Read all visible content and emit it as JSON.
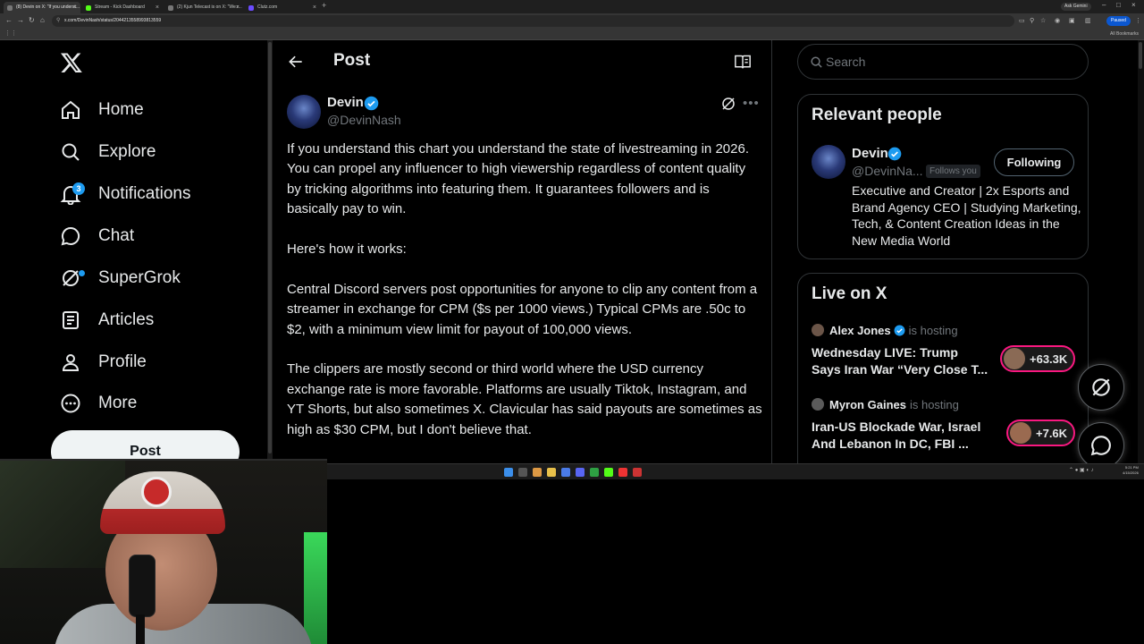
{
  "browser": {
    "tabs": [
      {
        "title": "(8) Devin on X: \"If you underst...",
        "active": true
      },
      {
        "title": "Stream - Kick Dashboard",
        "active": false
      },
      {
        "title": "(2) Kjun Telecast is on X: \"We r...",
        "active": false
      },
      {
        "title": "Clutz.com",
        "active": false
      }
    ],
    "url": "x.com/DevinNash/status/2044213558993813559",
    "ask_gemini": "Ask Gemini",
    "paused": "Paused",
    "all_bookmarks": "All Bookmarks"
  },
  "nav": {
    "items": [
      {
        "key": "home",
        "label": "Home"
      },
      {
        "key": "explore",
        "label": "Explore"
      },
      {
        "key": "notifications",
        "label": "Notifications",
        "badge": "3"
      },
      {
        "key": "chat",
        "label": "Chat"
      },
      {
        "key": "supergrok",
        "label": "SuperGrok"
      },
      {
        "key": "articles",
        "label": "Articles"
      },
      {
        "key": "profile",
        "label": "Profile"
      },
      {
        "key": "more",
        "label": "More"
      }
    ],
    "post_button": "Post"
  },
  "header": {
    "title": "Post"
  },
  "post": {
    "author_name": "Devin",
    "author_handle": "@DevinNash",
    "paragraphs": [
      "If you understand this chart you understand the state of livestreaming in 2026. You can propel any influencer to high viewership regardless of content quality by tricking algorithms into featuring them. It guarantees followers and is basically pay to win.",
      "Here's how it works:",
      "Central Discord servers post opportunities for anyone to clip any content from a streamer in exchange for CPM ($s per 1000 views.) Typical CPMs are .50c to $2, with a minimum view limit for payout of 100,000 views.",
      "The clippers are mostly second or third world where the USD currency exchange rate is more favorable. Platforms are usually Tiktok, Instagram, and YT Shorts, but also sometimes X. Clavicular has said payouts are sometimes as high as $30 CPM, but I don't believe that."
    ]
  },
  "search": {
    "placeholder": "Search"
  },
  "relevant_people": {
    "title": "Relevant people",
    "name": "Devin",
    "handle": "@DevinNa...",
    "follows_you": "Follows you",
    "following_button": "Following",
    "bio": "Executive and Creator | 2x Esports and Brand Agency CEO | Studying Marketing, Tech, & Content Creation Ideas in the New Media World"
  },
  "live_on_x": {
    "title": "Live on X",
    "items": [
      {
        "host": "Alex Jones",
        "hosting": "is hosting",
        "title": "Wednesday LIVE: Trump Says Iran War “Very Close T...",
        "count": "+63.3K"
      },
      {
        "host": "Myron Gaines",
        "hosting": "is hosting",
        "title": "Iran-US Blockade War, Israel And Lebanon In DC, FBI ...",
        "count": "+7.6K"
      }
    ]
  },
  "taskbar": {
    "time": "5:21 PM",
    "date": "4/15/2026"
  },
  "colors": {
    "accent": "#1d9bf0",
    "live": "#f91880",
    "background": "#000000",
    "text": "#e7e9ea",
    "muted": "#71767b"
  }
}
